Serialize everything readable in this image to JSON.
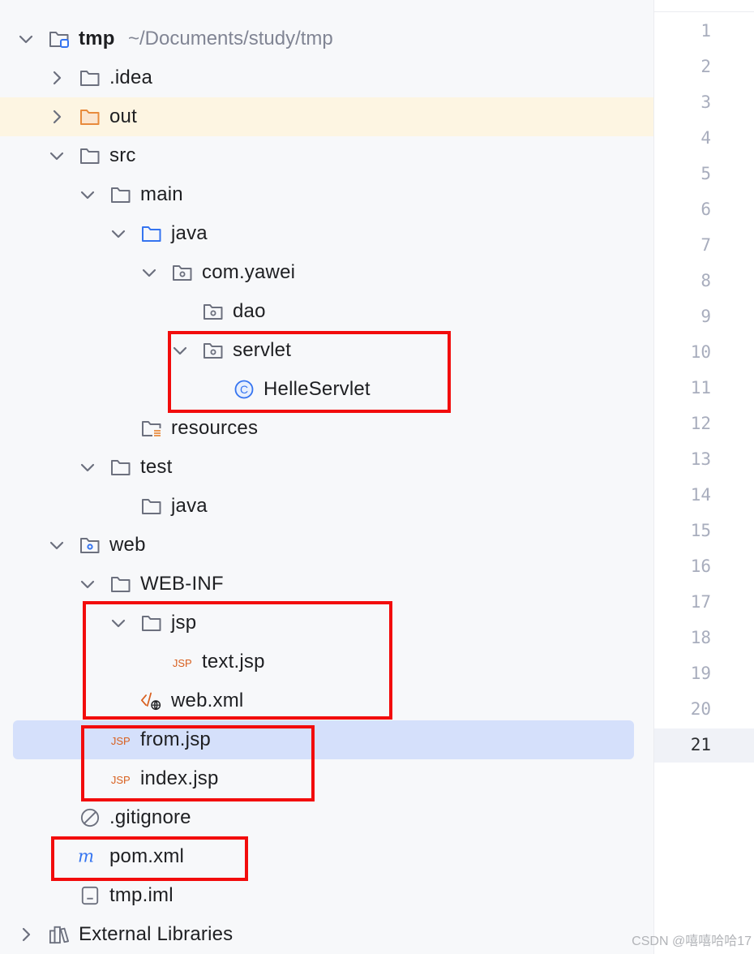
{
  "project": {
    "name": "tmp",
    "path": "~/Documents/study/tmp"
  },
  "tree": [
    {
      "label": "tmp",
      "type": "module-folder",
      "chevron": "down"
    },
    {
      "label": ".idea",
      "type": "folder",
      "chevron": "right"
    },
    {
      "label": "out",
      "type": "excluded-folder",
      "chevron": "right"
    },
    {
      "label": "src",
      "type": "folder",
      "chevron": "down"
    },
    {
      "label": "main",
      "type": "folder",
      "chevron": "down"
    },
    {
      "label": "java",
      "type": "source-folder",
      "chevron": "down"
    },
    {
      "label": "com.yawei",
      "type": "package-folder",
      "chevron": "down"
    },
    {
      "label": "dao",
      "type": "package-folder",
      "chevron": "none"
    },
    {
      "label": "servlet",
      "type": "package-folder",
      "chevron": "down"
    },
    {
      "label": "HelleServlet",
      "type": "java-class",
      "chevron": "none"
    },
    {
      "label": "resources",
      "type": "resources-folder",
      "chevron": "none"
    },
    {
      "label": "test",
      "type": "folder",
      "chevron": "down"
    },
    {
      "label": "java",
      "type": "folder",
      "chevron": "none"
    },
    {
      "label": "web",
      "type": "web-folder",
      "chevron": "down"
    },
    {
      "label": "WEB-INF",
      "type": "folder",
      "chevron": "down"
    },
    {
      "label": "jsp",
      "type": "folder",
      "chevron": "down"
    },
    {
      "label": "text.jsp",
      "type": "jsp-file",
      "chevron": "none"
    },
    {
      "label": "web.xml",
      "type": "web-xml-file",
      "chevron": "none"
    },
    {
      "label": "from.jsp",
      "type": "jsp-file",
      "chevron": "none"
    },
    {
      "label": "index.jsp",
      "type": "jsp-file",
      "chevron": "none"
    },
    {
      "label": ".gitignore",
      "type": "ignore-file",
      "chevron": "none"
    },
    {
      "label": "pom.xml",
      "type": "maven-file",
      "chevron": "none"
    },
    {
      "label": "tmp.iml",
      "type": "iml-file",
      "chevron": "none"
    },
    {
      "label": "External Libraries",
      "type": "libraries",
      "chevron": "right"
    }
  ],
  "selected_item": "from.jsp",
  "highlighted_item": "out",
  "icons": {
    "jsp_glyph": "JSP",
    "class_glyph": "C",
    "maven_glyph": "m"
  },
  "gutter": {
    "line_numbers": [
      "1",
      "2",
      "3",
      "4",
      "5",
      "6",
      "7",
      "8",
      "9",
      "10",
      "11",
      "12",
      "13",
      "14",
      "15",
      "16",
      "17",
      "18",
      "19",
      "20",
      "21"
    ],
    "current_line": "21"
  },
  "watermark": "CSDN @嘻嘻哈哈17",
  "colors": {
    "annotation_red": "#f20c0c",
    "selection": "#d5e0fb",
    "highlight_row": "#fdf5e2",
    "folder_gray": "#6c707e",
    "source_blue": "#3574f0",
    "excluded_orange": "#e88a3c",
    "jsp_orange": "#d85f1e"
  }
}
